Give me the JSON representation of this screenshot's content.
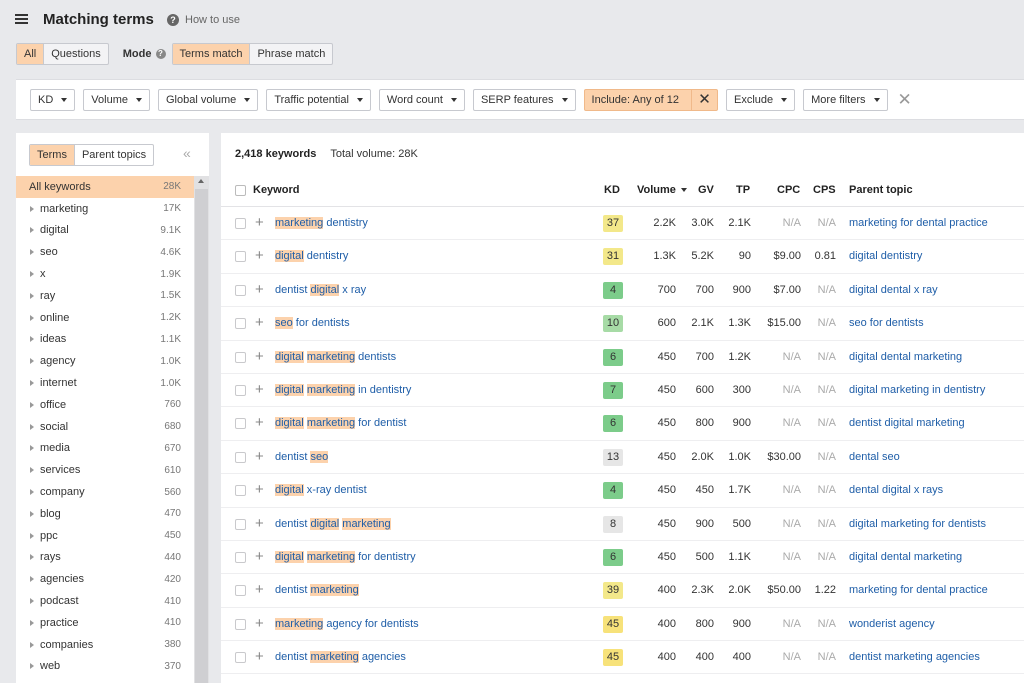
{
  "header": {
    "title": "Matching terms",
    "how_to_use": "How to use"
  },
  "tabs": {
    "all": "All",
    "questions": "Questions"
  },
  "mode": {
    "label": "Mode",
    "terms_match": "Terms match",
    "phrase_match": "Phrase match"
  },
  "filters": {
    "kd": "KD",
    "volume": "Volume",
    "global_volume": "Global volume",
    "traffic_potential": "Traffic potential",
    "word_count": "Word count",
    "serp_features": "SERP features",
    "include": "Include: Any of 12",
    "exclude": "Exclude",
    "more_filters": "More filters"
  },
  "sidebar": {
    "tab_terms": "Terms",
    "tab_parent_topics": "Parent topics",
    "items": [
      {
        "label": "All keywords",
        "count": "28K"
      },
      {
        "label": "marketing",
        "count": "17K"
      },
      {
        "label": "digital",
        "count": "9.1K"
      },
      {
        "label": "seo",
        "count": "4.6K"
      },
      {
        "label": "x",
        "count": "1.9K"
      },
      {
        "label": "ray",
        "count": "1.5K"
      },
      {
        "label": "online",
        "count": "1.2K"
      },
      {
        "label": "ideas",
        "count": "1.1K"
      },
      {
        "label": "agency",
        "count": "1.0K"
      },
      {
        "label": "internet",
        "count": "1.0K"
      },
      {
        "label": "office",
        "count": "760"
      },
      {
        "label": "social",
        "count": "680"
      },
      {
        "label": "media",
        "count": "670"
      },
      {
        "label": "services",
        "count": "610"
      },
      {
        "label": "company",
        "count": "560"
      },
      {
        "label": "blog",
        "count": "470"
      },
      {
        "label": "ppc",
        "count": "450"
      },
      {
        "label": "rays",
        "count": "440"
      },
      {
        "label": "agencies",
        "count": "420"
      },
      {
        "label": "podcast",
        "count": "410"
      },
      {
        "label": "practice",
        "count": "410"
      },
      {
        "label": "companies",
        "count": "380"
      },
      {
        "label": "web",
        "count": "370"
      }
    ]
  },
  "summary": {
    "keywords": "2,418 keywords",
    "total_volume": "Total volume: 28K"
  },
  "table": {
    "headers": {
      "keyword": "Keyword",
      "kd": "KD",
      "volume": "Volume",
      "gv": "GV",
      "tp": "TP",
      "cpc": "CPC",
      "cps": "CPS",
      "parent": "Parent topic"
    },
    "rows": [
      {
        "kw": [
          [
            "marketing",
            true
          ],
          [
            " dentistry",
            false
          ]
        ],
        "kd": "37",
        "kd_color": "#f3e88a",
        "volume": "2.2K",
        "gv": "3.0K",
        "tp": "2.1K",
        "cpc": "N/A",
        "cps": "N/A",
        "parent": "marketing for dental practice"
      },
      {
        "kw": [
          [
            "digital",
            true
          ],
          [
            " dentistry",
            false
          ]
        ],
        "kd": "31",
        "kd_color": "#f3e88a",
        "volume": "1.3K",
        "gv": "5.2K",
        "tp": "90",
        "cpc": "$9.00",
        "cps": "0.81",
        "parent": "digital dentistry"
      },
      {
        "kw": [
          [
            "dentist ",
            false
          ],
          [
            "digital",
            true
          ],
          [
            " x ray",
            false
          ]
        ],
        "kd": "4",
        "kd_color": "#7ccc8a",
        "volume": "700",
        "gv": "700",
        "tp": "900",
        "cpc": "$7.00",
        "cps": "N/A",
        "parent": "digital dental x ray"
      },
      {
        "kw": [
          [
            "seo",
            true
          ],
          [
            " for dentists",
            false
          ]
        ],
        "kd": "10",
        "kd_color": "#a7dba6",
        "volume": "600",
        "gv": "2.1K",
        "tp": "1.3K",
        "cpc": "$15.00",
        "cps": "N/A",
        "parent": "seo for dentists"
      },
      {
        "kw": [
          [
            "digital",
            true
          ],
          [
            " ",
            false
          ],
          [
            "marketing",
            true
          ],
          [
            " dentists",
            false
          ]
        ],
        "kd": "6",
        "kd_color": "#7ccc8a",
        "volume": "450",
        "gv": "700",
        "tp": "1.2K",
        "cpc": "N/A",
        "cps": "N/A",
        "parent": "digital dental marketing"
      },
      {
        "kw": [
          [
            "digital",
            true
          ],
          [
            " ",
            false
          ],
          [
            "marketing",
            true
          ],
          [
            " in dentistry",
            false
          ]
        ],
        "kd": "7",
        "kd_color": "#7ccc8a",
        "volume": "450",
        "gv": "600",
        "tp": "300",
        "cpc": "N/A",
        "cps": "N/A",
        "parent": "digital marketing in dentistry"
      },
      {
        "kw": [
          [
            "digital",
            true
          ],
          [
            " ",
            false
          ],
          [
            "marketing",
            true
          ],
          [
            " for dentist",
            false
          ]
        ],
        "kd": "6",
        "kd_color": "#7ccc8a",
        "volume": "450",
        "gv": "800",
        "tp": "900",
        "cpc": "N/A",
        "cps": "N/A",
        "parent": "dentist digital marketing"
      },
      {
        "kw": [
          [
            "dentist ",
            false
          ],
          [
            "seo",
            true
          ]
        ],
        "kd": "13",
        "kd_color": "#e6e6e6",
        "volume": "450",
        "gv": "2.0K",
        "tp": "1.0K",
        "cpc": "$30.00",
        "cps": "N/A",
        "parent": "dental seo"
      },
      {
        "kw": [
          [
            "digital",
            true
          ],
          [
            " x-ray dentist",
            false
          ]
        ],
        "kd": "4",
        "kd_color": "#7ccc8a",
        "volume": "450",
        "gv": "450",
        "tp": "1.7K",
        "cpc": "N/A",
        "cps": "N/A",
        "parent": "dental digital x rays"
      },
      {
        "kw": [
          [
            "dentist ",
            false
          ],
          [
            "digital",
            true
          ],
          [
            " ",
            false
          ],
          [
            "marketing",
            true
          ]
        ],
        "kd": "8",
        "kd_color": "#e6e6e6",
        "volume": "450",
        "gv": "900",
        "tp": "500",
        "cpc": "N/A",
        "cps": "N/A",
        "parent": "digital marketing for dentists"
      },
      {
        "kw": [
          [
            "digital",
            true
          ],
          [
            " ",
            false
          ],
          [
            "marketing",
            true
          ],
          [
            " for dentistry",
            false
          ]
        ],
        "kd": "6",
        "kd_color": "#7ccc8a",
        "volume": "450",
        "gv": "500",
        "tp": "1.1K",
        "cpc": "N/A",
        "cps": "N/A",
        "parent": "digital dental marketing"
      },
      {
        "kw": [
          [
            "dentist ",
            false
          ],
          [
            "marketing",
            true
          ]
        ],
        "kd": "39",
        "kd_color": "#f3e88a",
        "volume": "400",
        "gv": "2.3K",
        "tp": "2.0K",
        "cpc": "$50.00",
        "cps": "1.22",
        "parent": "marketing for dental practice"
      },
      {
        "kw": [
          [
            "marketing",
            true
          ],
          [
            " agency for dentists",
            false
          ]
        ],
        "kd": "45",
        "kd_color": "#f7e27a",
        "volume": "400",
        "gv": "800",
        "tp": "900",
        "cpc": "N/A",
        "cps": "N/A",
        "parent": "wonderist agency"
      },
      {
        "kw": [
          [
            "dentist ",
            false
          ],
          [
            "marketing",
            true
          ],
          [
            " agencies",
            false
          ]
        ],
        "kd": "45",
        "kd_color": "#f7e27a",
        "volume": "400",
        "gv": "400",
        "tp": "400",
        "cpc": "N/A",
        "cps": "N/A",
        "parent": "dentist marketing agencies"
      }
    ]
  }
}
